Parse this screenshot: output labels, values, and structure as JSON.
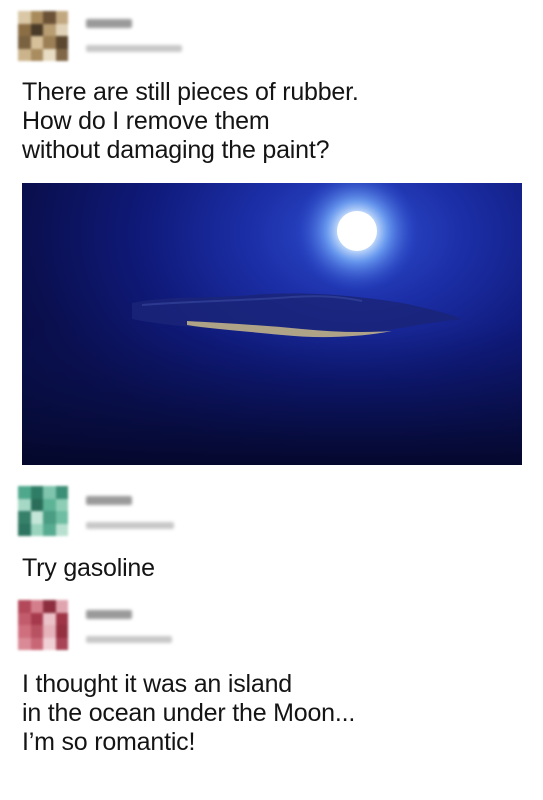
{
  "comments": [
    {
      "text": "There are still pieces of rubber.\nHow do I remove them\nwithout damaging the paint?",
      "avatar_colors": [
        "#d9c7a6",
        "#a88a5c",
        "#6b5236",
        "#c2a880",
        "#8c6e45",
        "#4a3a28",
        "#b89d72",
        "#e0d2b8",
        "#7a6240",
        "#d6c09a",
        "#9c7f55",
        "#5c472f",
        "#cbb48c",
        "#a98c60",
        "#e8dcc4",
        "#806747"
      ]
    },
    {
      "text": "Try gasoline",
      "avatar_colors": [
        "#4fa88c",
        "#2f7d66",
        "#7fc4ac",
        "#3b8f76",
        "#a6d8c6",
        "#2a6e5a",
        "#5cb396",
        "#8fceb6",
        "#367f69",
        "#c4e6d8",
        "#4a9c82",
        "#6fbda2",
        "#2d7560",
        "#9ad4be",
        "#57ab90",
        "#b8e0d0"
      ]
    },
    {
      "text": "I thought it was an island\nin the ocean under the Moon...\nI’m so romantic!",
      "avatar_colors": [
        "#b3485a",
        "#d47e8c",
        "#8c2e3e",
        "#e0a4ae",
        "#c25c6c",
        "#a63a4c",
        "#ecc2c9",
        "#9e3446",
        "#cf6f7e",
        "#b85262",
        "#e6b3bb",
        "#943040",
        "#d98a96",
        "#c96676",
        "#f0d0d5",
        "#a84456"
      ]
    }
  ],
  "meta_colors": {
    "name": "#9a9a9a",
    "date": "#c8c8c8"
  },
  "photo": {
    "moon_color": "#ffffff",
    "glow_color": "#7fb8ff",
    "land_color": "#c9b98a"
  }
}
